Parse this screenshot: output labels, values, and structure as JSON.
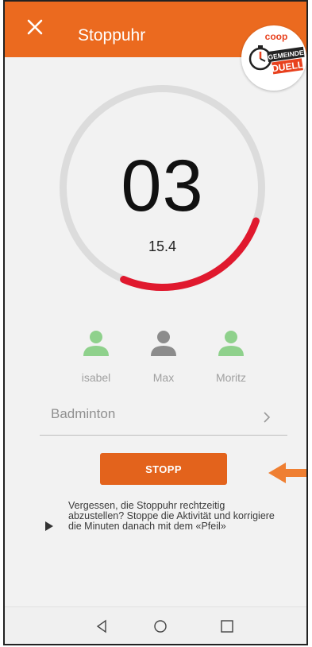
{
  "header": {
    "title": "Stoppuhr",
    "close_icon": "close-icon",
    "logo": {
      "brand_text": "coop",
      "line1": "GEMEINDE",
      "line2": "DUELL",
      "icon": "stopwatch-icon"
    }
  },
  "timer": {
    "minutes_display": "03",
    "seconds_display": "15.4",
    "progress_fraction": 0.26,
    "ring_color": "#e0192e",
    "track_color": "#dcdcdc"
  },
  "participants": [
    {
      "name": "isabel",
      "color": "#8fd18c"
    },
    {
      "name": "Max",
      "color": "#8c8c8c"
    },
    {
      "name": "Moritz",
      "color": "#8fd18c"
    }
  ],
  "activity": {
    "label": "Badminton",
    "chevron_icon": "chevron-right-icon"
  },
  "stop_button": {
    "label": "STOPP",
    "color": "#e3631c"
  },
  "hint_arrow": {
    "icon": "arrow-left-icon",
    "color": "#ef7f32"
  },
  "info": {
    "icon": "play-icon",
    "text": "Vergessen, die Stoppuhr rechtzeitig abzustellen? Stoppe die Aktivität und korrigiere die Minuten danach mit dem «Pfeil»"
  },
  "navbar": {
    "back_icon": "nav-back-icon",
    "home_icon": "nav-home-icon",
    "recents_icon": "nav-recents-icon"
  },
  "accent_color": "#eb6a1f"
}
